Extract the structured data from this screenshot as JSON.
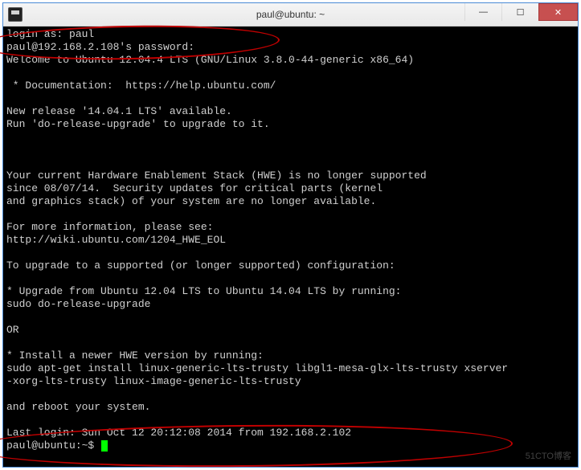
{
  "window": {
    "title": "paul@ubuntu: ~",
    "controls": {
      "minimize": "—",
      "maximize": "☐",
      "close": "✕"
    }
  },
  "terminal": {
    "lines": {
      "l1": "login as: paul",
      "l2": "paul@192.168.2.108's password:",
      "l3": "Welcome to Ubuntu 12.04.4 LTS (GNU/Linux 3.8.0-44-generic x86_64)",
      "l4": "",
      "l5": " * Documentation:  https://help.ubuntu.com/",
      "l6": "",
      "l7": "New release '14.04.1 LTS' available.",
      "l8": "Run 'do-release-upgrade' to upgrade to it.",
      "l9": "",
      "l10": "",
      "l11": "",
      "l12": "Your current Hardware Enablement Stack (HWE) is no longer supported",
      "l13": "since 08/07/14.  Security updates for critical parts (kernel",
      "l14": "and graphics stack) of your system are no longer available.",
      "l15": "",
      "l16": "For more information, please see:",
      "l17": "http://wiki.ubuntu.com/1204_HWE_EOL",
      "l18": "",
      "l19": "To upgrade to a supported (or longer supported) configuration:",
      "l20": "",
      "l21": "* Upgrade from Ubuntu 12.04 LTS to Ubuntu 14.04 LTS by running:",
      "l22": "sudo do-release-upgrade",
      "l23": "",
      "l24": "OR",
      "l25": "",
      "l26": "* Install a newer HWE version by running:",
      "l27": "sudo apt-get install linux-generic-lts-trusty libgl1-mesa-glx-lts-trusty xserver",
      "l28": "-xorg-lts-trusty linux-image-generic-lts-trusty",
      "l29": "",
      "l30": "and reboot your system.",
      "l31": "",
      "l32": "Last login: Sun Oct 12 20:12:08 2014 from 192.168.2.102",
      "prompt": "paul@ubuntu:~$ "
    }
  },
  "watermark": "51CTO博客"
}
